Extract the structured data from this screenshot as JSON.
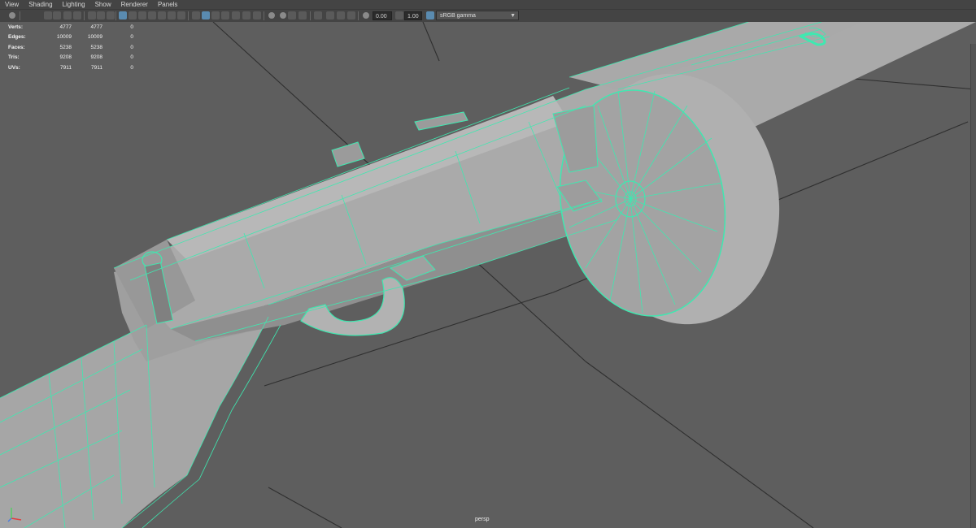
{
  "menu": [
    "View",
    "Shading",
    "Lighting",
    "Show",
    "Renderer",
    "Panels"
  ],
  "toolbar": {
    "exposure": "0.00",
    "gamma": "1.00",
    "color_space": "sRGB gamma"
  },
  "hud": {
    "rows": [
      {
        "label": "Verts:",
        "v1": "4777",
        "v2": "4777",
        "v3": "0"
      },
      {
        "label": "Edges:",
        "v1": "10009",
        "v2": "10009",
        "v3": "0"
      },
      {
        "label": "Faces:",
        "v1": "5238",
        "v2": "5238",
        "v3": "0"
      },
      {
        "label": "Tris:",
        "v1": "9208",
        "v2": "9208",
        "v3": "0"
      },
      {
        "label": "UVs:",
        "v1": "7911",
        "v2": "7911",
        "v3": "0"
      }
    ]
  },
  "camera": "persp",
  "colors": {
    "wire": "#3fe8b0",
    "mesh": "#a9a9a9",
    "background": "#5e5e5e"
  }
}
